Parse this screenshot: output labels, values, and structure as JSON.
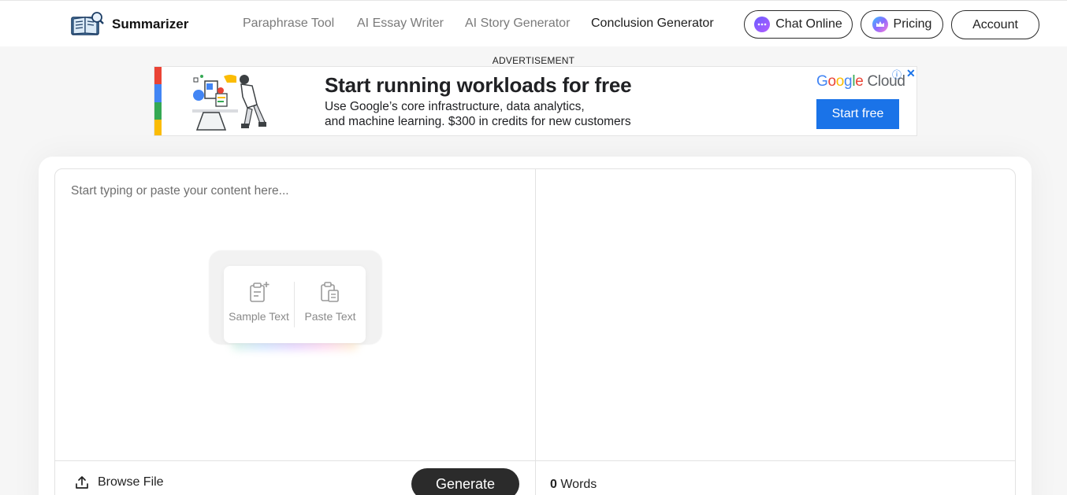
{
  "header": {
    "brand": "Summarizer",
    "nav": [
      {
        "label": "Paraphrase Tool"
      },
      {
        "label": "AI Essay Writer"
      },
      {
        "label": "AI Story Generator"
      },
      {
        "label": "Conclusion Generator"
      }
    ],
    "chat_label": "Chat Online",
    "pricing_label": "Pricing",
    "account_label": "Account"
  },
  "ad": {
    "label": "ADVERTISEMENT",
    "headline": "Start running workloads for free",
    "line1": "Use Google’s core infrastructure, data analytics,",
    "line2": "and machine learning. $300 in credits for new customers",
    "brand_google": "Google",
    "brand_cloud": "Cloud",
    "cta": "Start free",
    "info_icon": "ⓘ",
    "close_icon": "✕"
  },
  "editor": {
    "placeholder": "Start typing or paste your content here...",
    "sample_label": "Sample Text",
    "paste_label": "Paste Text",
    "browse_label": "Browse File",
    "generate_label": "Generate",
    "word_count": "0",
    "words_label": "Words"
  },
  "colors": {
    "accent_dark": "#2b2b2b",
    "ad_blue": "#1a73e8",
    "google_blue": "#4285f4",
    "google_red": "#ea4335",
    "google_yellow": "#fbbc04",
    "google_green": "#34a853"
  }
}
